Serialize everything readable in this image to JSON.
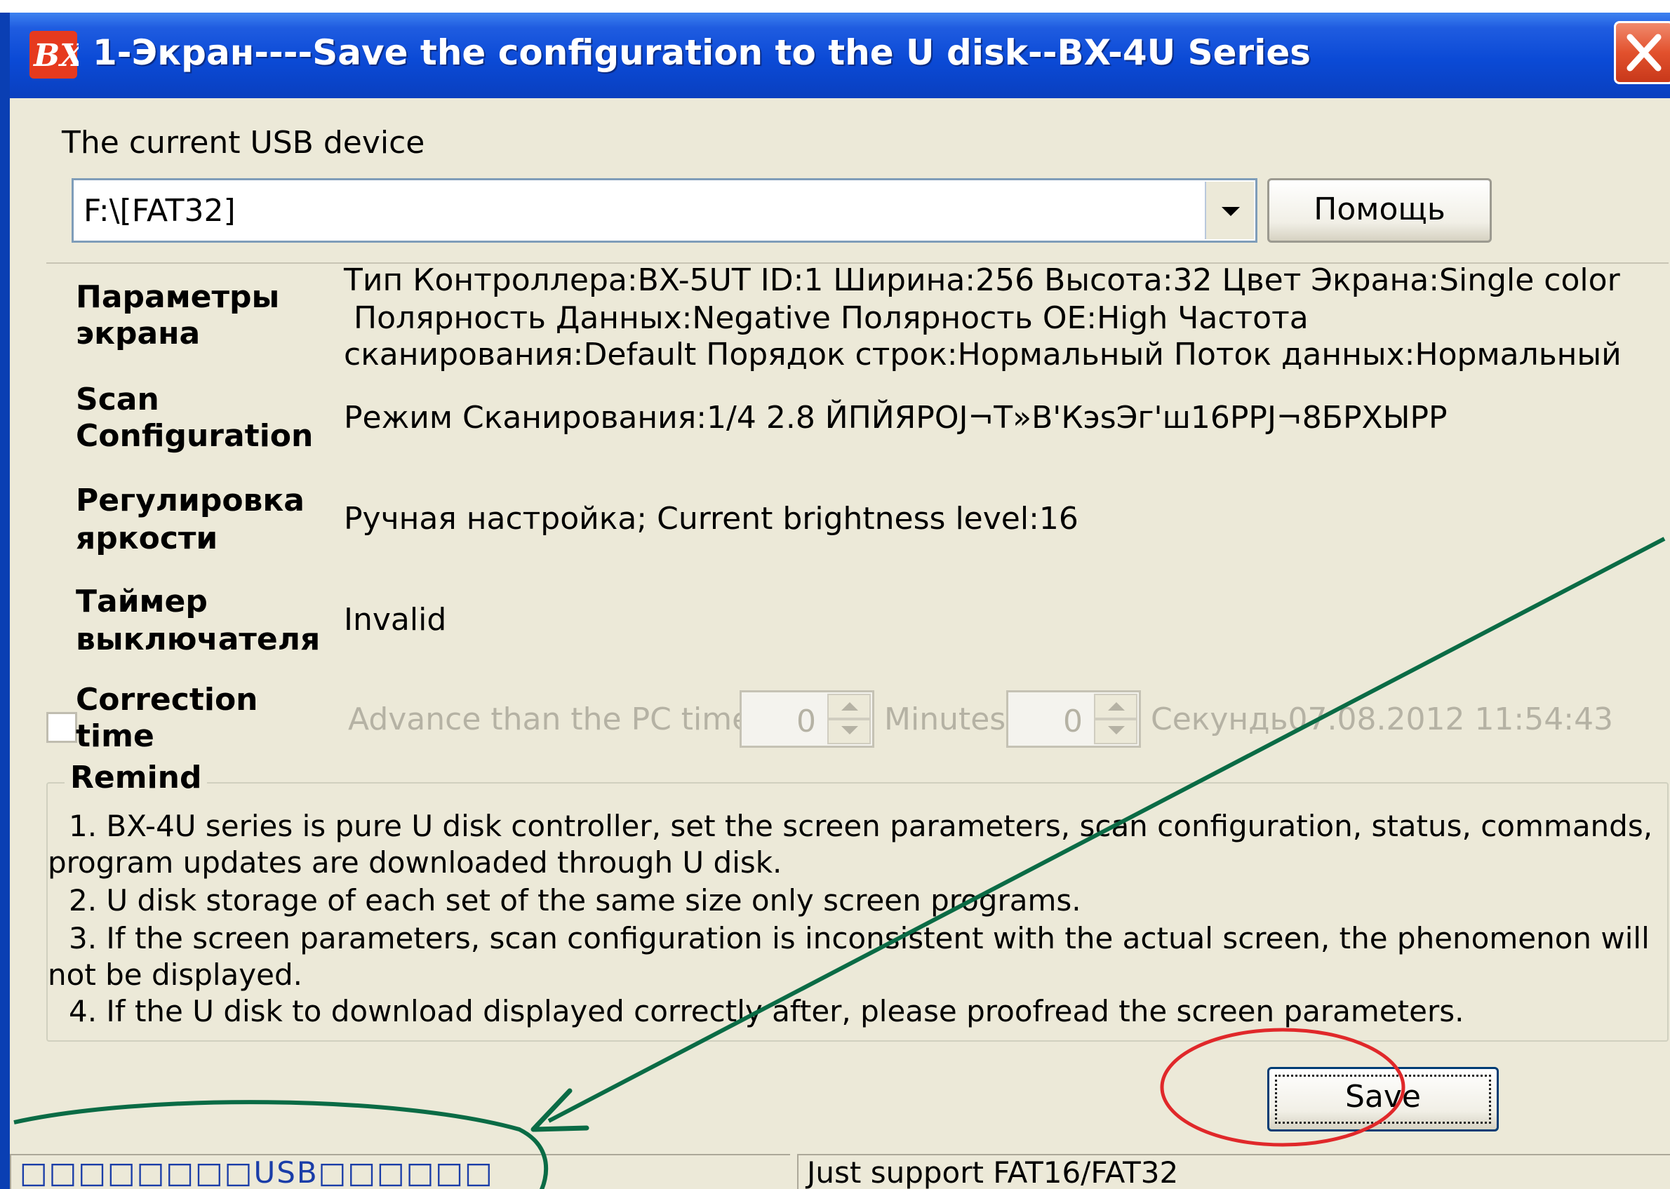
{
  "window": {
    "title": "1-Экран----Save the configuration to the U disk--BX-4U Series",
    "app_icon_text": "BX",
    "close_icon": "close-icon"
  },
  "usb": {
    "label": "The current USB device",
    "value": "F:\\[FAT32]",
    "help_button": "Помощь"
  },
  "screen_params": {
    "label_line1": "Параметры",
    "label_line2": "экрана",
    "line1": "Тип Контроллера:BX-5UT   ID:1   Ширина:256   Высота:32   Цвет Экрана:Single color",
    "line2": "Полярность Данных:Negative   Полярность OE:High   Частота",
    "line3": "сканирования:Default   Порядок строк:Нормальный   Поток данных:Нормальный"
  },
  "scan_config": {
    "label_line1": "Scan",
    "label_line2": "Configuration",
    "value": "Режим Сканирования:1/4    2.8  ЙПЙЯРОЈ¬Т»В'КэsЭг'ш16РРЈ¬8БРХЫРР"
  },
  "brightness": {
    "label_line1": "Регулировка",
    "label_line2": "яркости",
    "value": "Ручная настройка;  Current brightness level:16"
  },
  "timer": {
    "label_line1": "Таймер",
    "label_line2": "выключателя",
    "value": "Invalid"
  },
  "correction": {
    "label_line1": "Correction",
    "label_line2": "time",
    "advance_text": "Advance than the PC time",
    "minutes_value": "0",
    "minutes_label": "Minutes",
    "seconds_value": "0",
    "seconds_label": "Секундь07.08.2012 11:54:43"
  },
  "remind": {
    "title": "Remind",
    "lines": [
      "1.  BX-4U series is pure U disk controller, set the screen parameters, scan configuration, status, commands,",
      "program updates are downloaded through U disk.",
      "2.  U disk storage of each set of the same size only screen programs.",
      "3.  If the screen parameters, scan configuration is inconsistent with the actual screen, the phenomenon will",
      "not be displayed.",
      "4.  If the U disk to download displayed correctly after, please proofread the screen parameters."
    ]
  },
  "save_button": "Save",
  "status": {
    "left": "□□□□□□□□USB□□□□□□",
    "right": "Just support FAT16/FAT32"
  },
  "colors": {
    "titlebar": "#0b4ad6",
    "window_bg": "#ece9d8",
    "annotation_green": "#0a6b45",
    "annotation_red": "#e0282a"
  }
}
